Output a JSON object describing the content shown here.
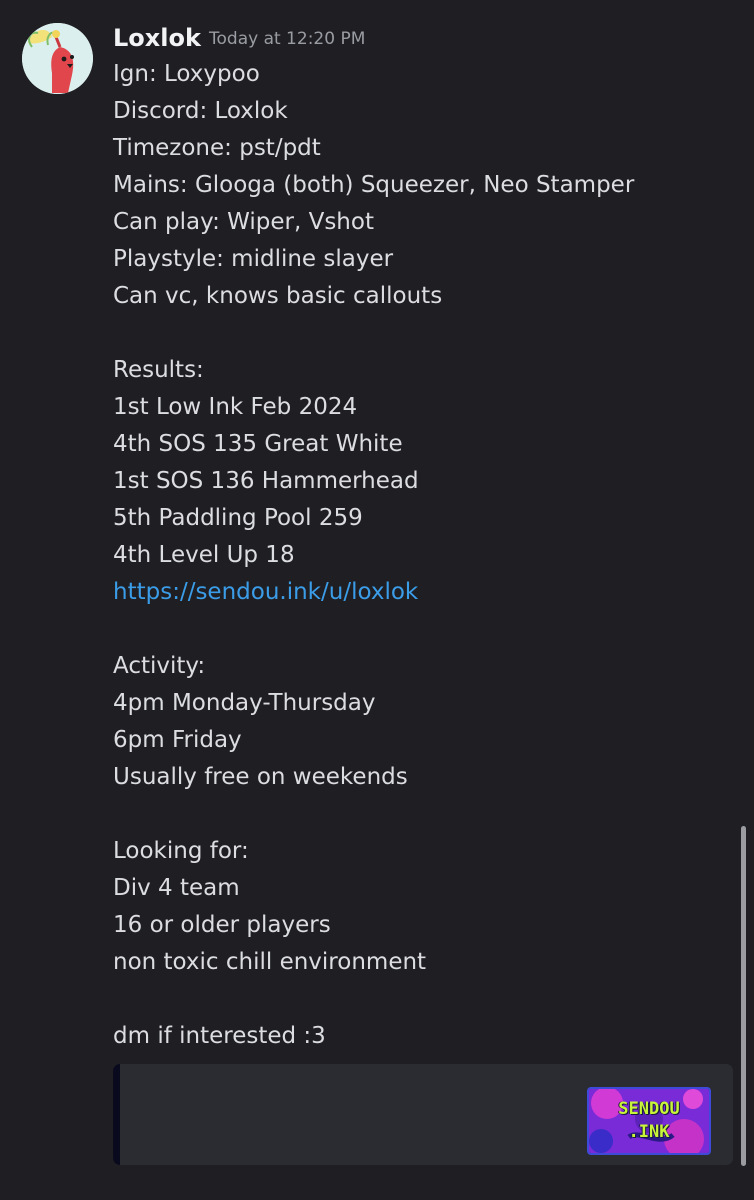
{
  "author": {
    "username": "Loxlok",
    "timestamp": "Today at 12:20 PM",
    "avatar_icon": "pikmin-icon"
  },
  "message": {
    "lines": [
      {
        "text": "Ign: Loxypoo",
        "type": "text"
      },
      {
        "text": "Discord: Loxlok",
        "type": "text"
      },
      {
        "text": "Timezone: pst/pdt",
        "type": "text"
      },
      {
        "text": "Mains: Glooga (both) Squeezer, Neo Stamper",
        "type": "text"
      },
      {
        "text": "Can play: Wiper, Vshot",
        "type": "text"
      },
      {
        "text": "Playstyle: midline slayer",
        "type": "text"
      },
      {
        "text": "Can vc, knows basic callouts",
        "type": "text"
      },
      {
        "text": "",
        "type": "blank"
      },
      {
        "text": "Results:",
        "type": "text"
      },
      {
        "text": "1st Low Ink Feb 2024",
        "type": "text"
      },
      {
        "text": "4th SOS 135 Great White",
        "type": "text"
      },
      {
        "text": "1st SOS 136 Hammerhead",
        "type": "text"
      },
      {
        "text": "5th Paddling Pool 259",
        "type": "text"
      },
      {
        "text": "4th Level Up 18",
        "type": "text"
      },
      {
        "text": "https://sendou.ink/u/loxlok",
        "type": "link"
      },
      {
        "text": "",
        "type": "blank"
      },
      {
        "text": "Activity:",
        "type": "text"
      },
      {
        "text": "4pm Monday-Thursday",
        "type": "text"
      },
      {
        "text": "6pm Friday",
        "type": "text"
      },
      {
        "text": "Usually free on weekends",
        "type": "text"
      },
      {
        "text": "",
        "type": "blank"
      },
      {
        "text": "Looking for:",
        "type": "text"
      },
      {
        "text": "Div 4 team",
        "type": "text"
      },
      {
        "text": "16 or older players",
        "type": "text"
      },
      {
        "text": "non toxic chill environment",
        "type": "text"
      },
      {
        "text": "",
        "type": "blank"
      },
      {
        "text": "dm if interested :3",
        "type": "text"
      }
    ]
  },
  "embed": {
    "thumbnail_line1": "SENDOU",
    "thumbnail_line2": ".INK",
    "thumbnail_icon": "sendou-ink-logo"
  },
  "colors": {
    "background": "#1f1f23",
    "text": "#dcdde1",
    "link": "#3b9ce8",
    "timestamp": "#9a9ca3",
    "embed_background": "#2b2c31"
  }
}
